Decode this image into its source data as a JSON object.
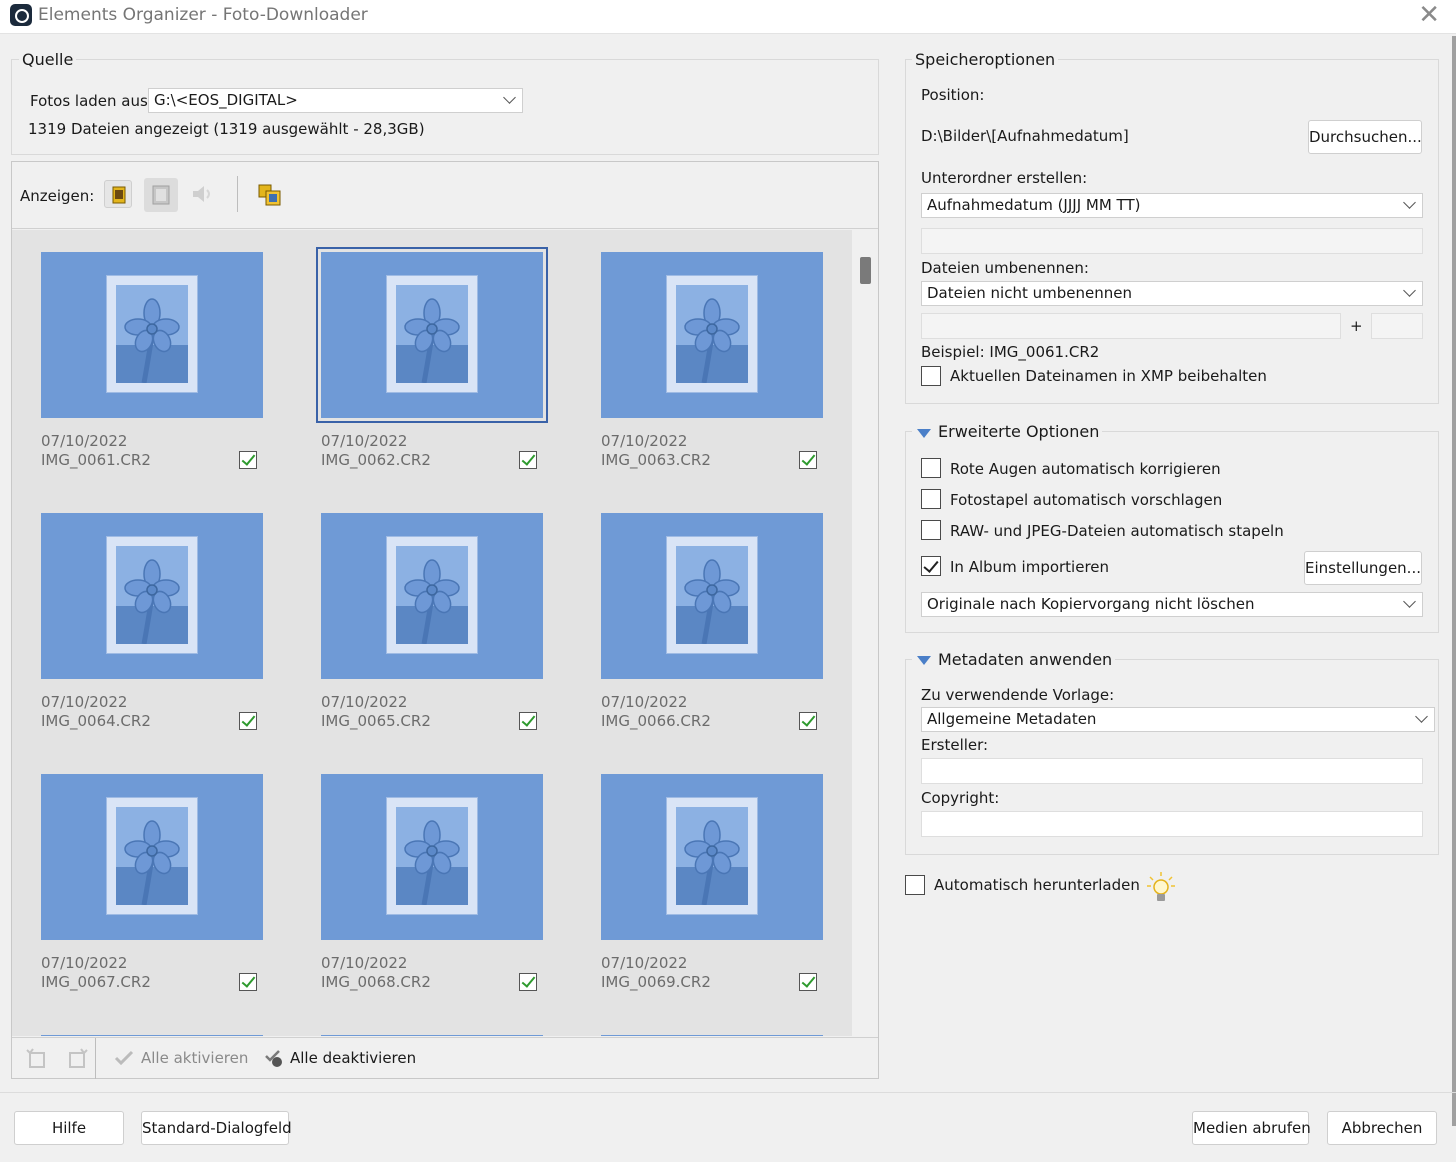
{
  "window": {
    "title": "Elements Organizer - Foto-Downloader",
    "close_icon": "close-icon"
  },
  "source": {
    "group_title": "Quelle",
    "load_from_label": "Fotos laden aus:",
    "load_from_value": "G:\\<EOS_DIGITAL>",
    "summary": "1319 Dateien angezeigt (1319 ausgewählt - 28,3GB)"
  },
  "toolbar": {
    "show_label": "Anzeigen:",
    "icons": [
      "photo-filter-icon",
      "video-filter-icon",
      "audio-filter-icon",
      "duplicate-filter-icon"
    ]
  },
  "thumbnails": [
    {
      "date": "07/10/2022",
      "file": "IMG_0061.CR2",
      "checked": true
    },
    {
      "date": "07/10/2022",
      "file": "IMG_0062.CR2",
      "checked": true,
      "selected": true
    },
    {
      "date": "07/10/2022",
      "file": "IMG_0063.CR2",
      "checked": true
    },
    {
      "date": "07/10/2022",
      "file": "IMG_0064.CR2",
      "checked": true
    },
    {
      "date": "07/10/2022",
      "file": "IMG_0065.CR2",
      "checked": true
    },
    {
      "date": "07/10/2022",
      "file": "IMG_0066.CR2",
      "checked": true
    },
    {
      "date": "07/10/2022",
      "file": "IMG_0067.CR2",
      "checked": true
    },
    {
      "date": "07/10/2022",
      "file": "IMG_0068.CR2",
      "checked": true
    },
    {
      "date": "07/10/2022",
      "file": "IMG_0069.CR2",
      "checked": true
    }
  ],
  "grid_actions": {
    "check_all": "Alle aktivieren",
    "uncheck_all": "Alle deaktivieren"
  },
  "save_options": {
    "group_title": "Speicheroptionen",
    "position_label": "Position:",
    "position_value": "D:\\Bilder\\[Aufnahmedatum]",
    "browse_button": "Durchsuchen...",
    "subfolder_label": "Unterordner erstellen:",
    "subfolder_value": "Aufnahmedatum (JJJJ MM TT)",
    "subfolder_custom": "",
    "rename_label": "Dateien umbenennen:",
    "rename_value": "Dateien nicht umbenennen",
    "rename_text": "",
    "rename_plus": "+",
    "rename_number": "",
    "example": "Beispiel: IMG_0061.CR2",
    "keep_xmp_label": "Aktuellen Dateinamen in XMP beibehalten",
    "keep_xmp_checked": false
  },
  "advanced": {
    "group_title": "Erweiterte Optionen",
    "red_eye": "Rote Augen automatisch korrigieren",
    "stacks": "Fotostapel automatisch vorschlagen",
    "raw_jpeg": "RAW- und JPEG-Dateien automatisch stapeln",
    "album": "In Album importieren",
    "album_checked": true,
    "settings_button": "Einstellungen...",
    "after_copy_value": "Originale nach Kopiervorgang nicht löschen"
  },
  "metadata": {
    "group_title": "Metadaten anwenden",
    "template_label": "Zu verwendende Vorlage:",
    "template_value": "Allgemeine Metadaten",
    "author_label": "Ersteller:",
    "author_value": "",
    "copyright_label": "Copyright:",
    "copyright_value": ""
  },
  "auto_download": {
    "label": "Automatisch herunterladen",
    "checked": false,
    "tip_icon": "lightbulb-icon"
  },
  "footer": {
    "help": "Hilfe",
    "standard_dialog": "Standard-Dialogfeld",
    "get_media": "Medien abrufen",
    "cancel": "Abbrechen"
  },
  "colors": {
    "thumb_bg": "#6f9ad6",
    "check_green": "#2e9a2e",
    "selection": "#3a62a8",
    "accent": "#4a7fc8"
  }
}
